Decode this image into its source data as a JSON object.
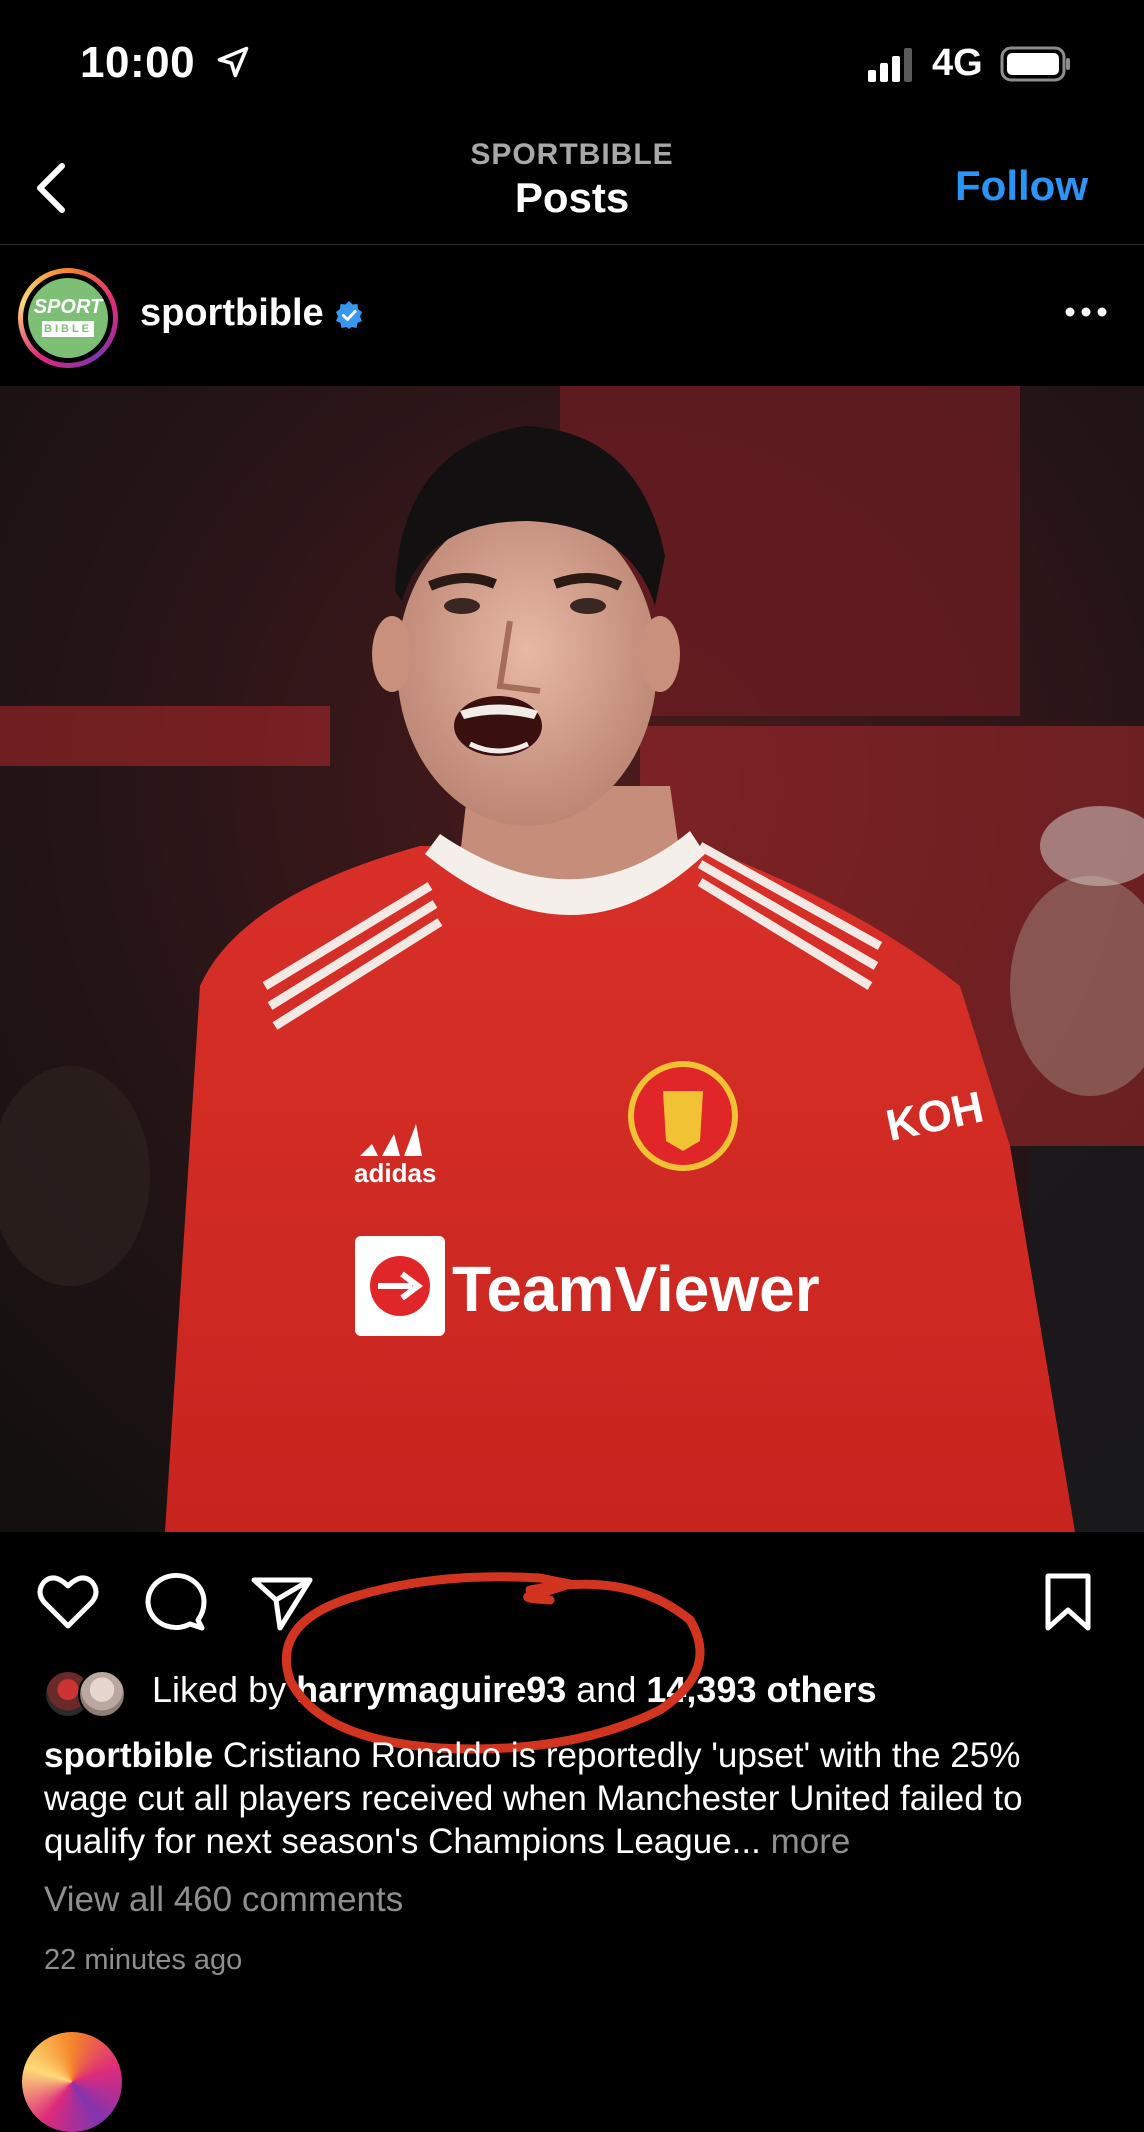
{
  "status_bar": {
    "time": "10:00",
    "network": "4G"
  },
  "header": {
    "subtitle": "SPORTBIBLE",
    "title": "Posts",
    "follow_label": "Follow"
  },
  "post": {
    "username": "sportbible",
    "avatar_logo_top": "SPORT",
    "avatar_logo_bottom": "BIBLE",
    "photo_jersey_sponsor": "TeamViewer",
    "photo_jersey_brand": "adidas",
    "photo_sleeve_text": "KOH",
    "likes": {
      "prefix": "Liked by",
      "user": "harrymaguire93",
      "conjunction": "and",
      "count": "14,393 others"
    },
    "caption": {
      "user": "sportbible",
      "text": "Cristiano Ronaldo is reportedly 'upset' with the 25% wage cut all players received when Manchester United failed to qualify for next season's Champions League...",
      "more": "more"
    },
    "comments_link": "View all 460 comments",
    "timestamp": "22 minutes ago"
  },
  "icons": {
    "location": "location-arrow-icon",
    "signal": "signal-bars-icon",
    "battery": "battery-icon",
    "back": "chevron-left-icon",
    "verified": "verified-badge-icon",
    "more": "more-dots-icon",
    "like": "heart-icon",
    "comment": "comment-bubble-icon",
    "share": "paper-plane-icon",
    "save": "bookmark-icon"
  },
  "colors": {
    "follow": "#2b95f5",
    "verified": "#3897f0",
    "annotation": "#d2341f",
    "jersey": "#d42a24"
  }
}
